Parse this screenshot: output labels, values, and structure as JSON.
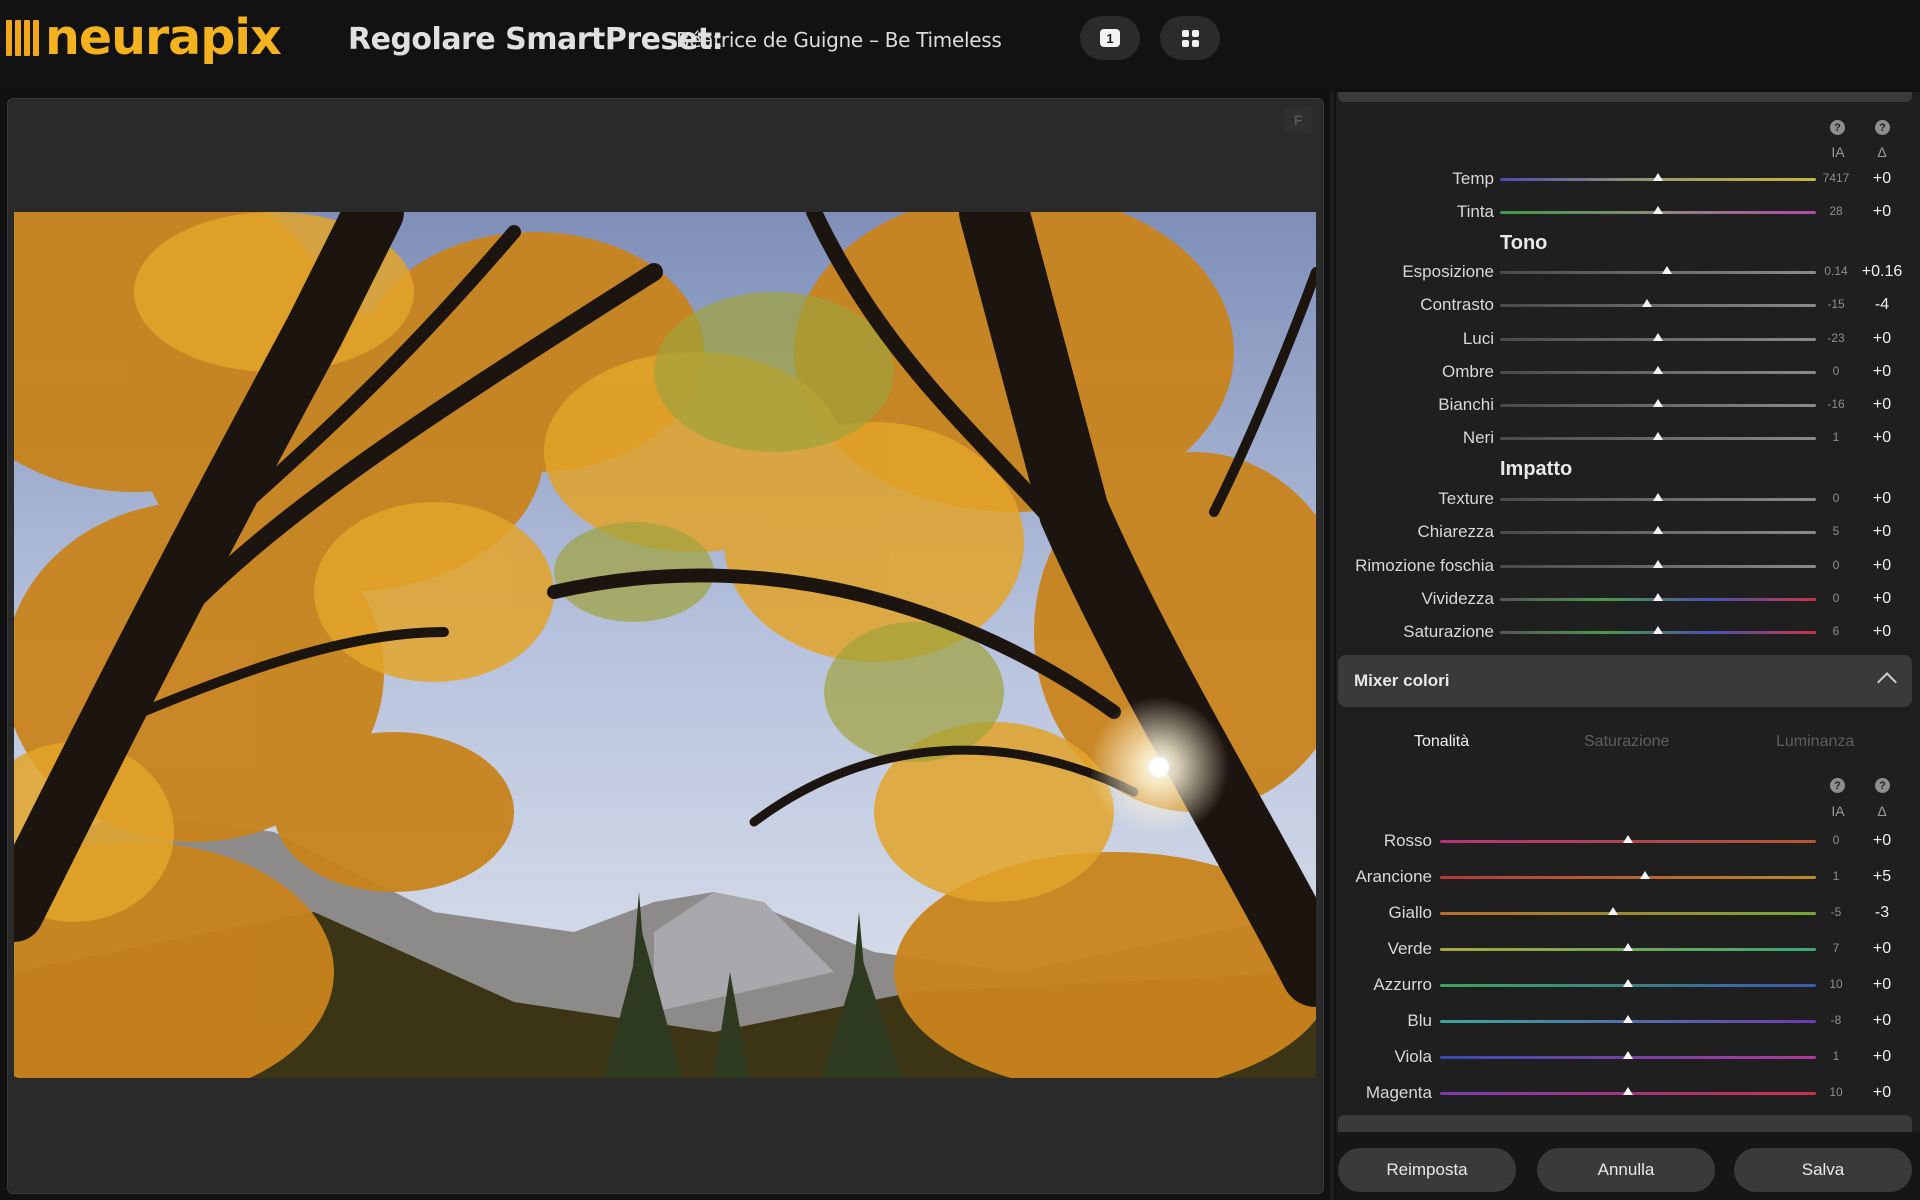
{
  "app": {
    "logo_text": "neurapix"
  },
  "header": {
    "title": "Regolare SmartPreset:",
    "preset_name": "Béatrice de Guigne – Be Timeless",
    "single_view_label": "1"
  },
  "viewer": {
    "f_label": "F"
  },
  "panel": {
    "col_ai": "IA",
    "col_delta": "Δ",
    "help_glyph": "?",
    "section_tone": "Tono",
    "section_impact": "Impatto",
    "white_balance": [
      {
        "label": "Temp",
        "ai": "7417",
        "delta": "+0",
        "pos": 0.5
      },
      {
        "label": "Tinta",
        "ai": "28",
        "delta": "+0",
        "pos": 0.5
      }
    ],
    "tone": [
      {
        "label": "Esposizione",
        "ai": "0.14",
        "delta": "+0.16",
        "pos": 0.53
      },
      {
        "label": "Contrasto",
        "ai": "-15",
        "delta": "-4",
        "pos": 0.465
      },
      {
        "label": "Luci",
        "ai": "-23",
        "delta": "+0",
        "pos": 0.5
      },
      {
        "label": "Ombre",
        "ai": "0",
        "delta": "+0",
        "pos": 0.5
      },
      {
        "label": "Bianchi",
        "ai": "-16",
        "delta": "+0",
        "pos": 0.5
      },
      {
        "label": "Neri",
        "ai": "1",
        "delta": "+0",
        "pos": 0.5
      }
    ],
    "impact": [
      {
        "label": "Texture",
        "ai": "0",
        "delta": "+0",
        "pos": 0.5
      },
      {
        "label": "Chiarezza",
        "ai": "5",
        "delta": "+0",
        "pos": 0.5
      },
      {
        "label": "Rimozione foschia",
        "ai": "0",
        "delta": "+0",
        "pos": 0.5
      },
      {
        "label": "Vividezza",
        "ai": "0",
        "delta": "+0",
        "pos": 0.5
      },
      {
        "label": "Saturazione",
        "ai": "6",
        "delta": "+0",
        "pos": 0.5
      }
    ],
    "mixer": {
      "title": "Mixer colori",
      "tabs": [
        "Tonalità",
        "Saturazione",
        "Luminanza"
      ],
      "active_tab": "Tonalità",
      "rows": [
        {
          "label": "Rosso",
          "ai": "0",
          "delta": "+0",
          "pos": 0.5
        },
        {
          "label": "Arancione",
          "ai": "1",
          "delta": "+5",
          "pos": 0.545
        },
        {
          "label": "Giallo",
          "ai": "-5",
          "delta": "-3",
          "pos": 0.46
        },
        {
          "label": "Verde",
          "ai": "7",
          "delta": "+0",
          "pos": 0.5
        },
        {
          "label": "Azzurro",
          "ai": "10",
          "delta": "+0",
          "pos": 0.5
        },
        {
          "label": "Blu",
          "ai": "-8",
          "delta": "+0",
          "pos": 0.5
        },
        {
          "label": "Viola",
          "ai": "1",
          "delta": "+0",
          "pos": 0.5
        },
        {
          "label": "Magenta",
          "ai": "10",
          "delta": "+0",
          "pos": 0.5
        }
      ]
    }
  },
  "footer": {
    "reset": "Reimposta",
    "cancel": "Annulla",
    "save": "Salva"
  },
  "colors": {
    "brand": "#f5b21f",
    "background": "#111111",
    "panel": "#1f1f1f"
  }
}
